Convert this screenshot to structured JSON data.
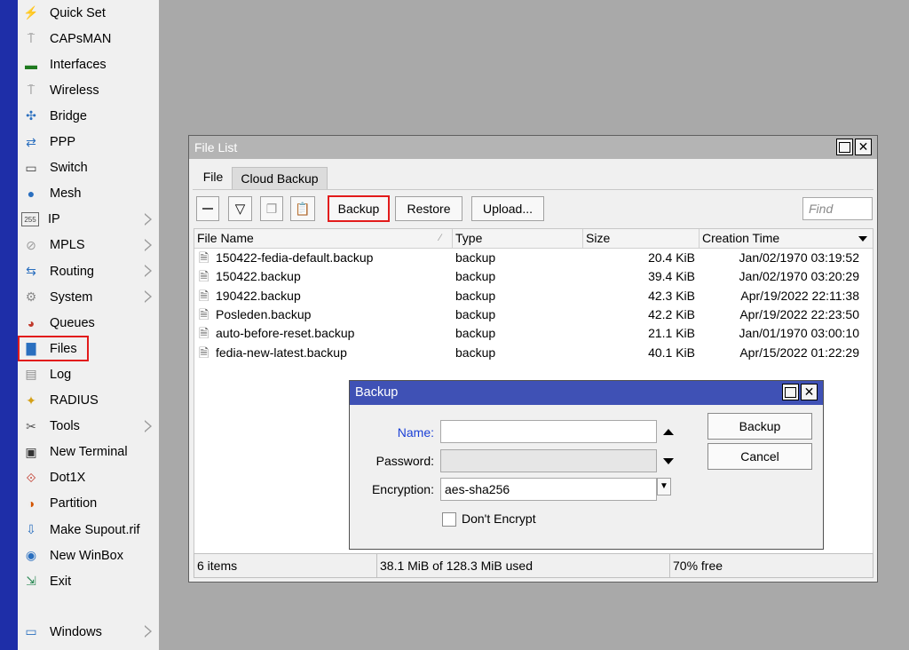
{
  "sidebar": {
    "items": [
      {
        "label": "Quick Set",
        "icon": "wand-icon",
        "glyph": "⚡",
        "color": "#b08900",
        "submenu": false
      },
      {
        "label": "CAPsMAN",
        "icon": "antenna-icon",
        "glyph": "⍑",
        "color": "#7a7a7a",
        "submenu": false
      },
      {
        "label": "Interfaces",
        "icon": "interfaces-icon",
        "glyph": "▬",
        "color": "#1f7a1f",
        "submenu": false
      },
      {
        "label": "Wireless",
        "icon": "wireless-icon",
        "glyph": "⍑",
        "color": "#7a7a7a",
        "submenu": false
      },
      {
        "label": "Bridge",
        "icon": "bridge-icon",
        "glyph": "✣",
        "color": "#2a6fbf",
        "submenu": false
      },
      {
        "label": "PPP",
        "icon": "ppp-icon",
        "glyph": "⇄",
        "color": "#2a6fbf",
        "submenu": false
      },
      {
        "label": "Switch",
        "icon": "switch-icon",
        "glyph": "▭",
        "color": "#444444",
        "submenu": false
      },
      {
        "label": "Mesh",
        "icon": "mesh-icon",
        "glyph": "●",
        "color": "#2a6fbf",
        "submenu": false
      },
      {
        "label": "IP",
        "icon": "ip-icon",
        "glyph": "255",
        "color": "#444444",
        "submenu": true
      },
      {
        "label": "MPLS",
        "icon": "mpls-icon",
        "glyph": "⊘",
        "color": "#9a9a9a",
        "submenu": true
      },
      {
        "label": "Routing",
        "icon": "routing-icon",
        "glyph": "⇆",
        "color": "#2a6fbf",
        "submenu": true
      },
      {
        "label": "System",
        "icon": "gear-icon",
        "glyph": "⚙",
        "color": "#8a8a8a",
        "submenu": true
      },
      {
        "label": "Queues",
        "icon": "queues-icon",
        "glyph": "◕",
        "color": "#c0392b",
        "submenu": false
      },
      {
        "label": "Files",
        "icon": "folder-icon",
        "glyph": "▇",
        "color": "#2a6fbf",
        "submenu": false
      },
      {
        "label": "Log",
        "icon": "log-icon",
        "glyph": "▤",
        "color": "#8a8a8a",
        "submenu": false
      },
      {
        "label": "RADIUS",
        "icon": "radius-icon",
        "glyph": "✦",
        "color": "#d4a017",
        "submenu": false
      },
      {
        "label": "Tools",
        "icon": "tools-icon",
        "glyph": "✂",
        "color": "#555555",
        "submenu": true
      },
      {
        "label": "New Terminal",
        "icon": "terminal-icon",
        "glyph": "▣",
        "color": "#333333",
        "submenu": false
      },
      {
        "label": "Dot1X",
        "icon": "dot1x-icon",
        "glyph": "⟐",
        "color": "#c0392b",
        "submenu": false
      },
      {
        "label": "Partition",
        "icon": "partition-icon",
        "glyph": "◑",
        "color": "#d35400",
        "submenu": false
      },
      {
        "label": "Make Supout.rif",
        "icon": "supout-icon",
        "glyph": "⇩",
        "color": "#2a6fbf",
        "submenu": false
      },
      {
        "label": "New WinBox",
        "icon": "winbox-icon",
        "glyph": "◉",
        "color": "#2a6fbf",
        "submenu": false
      },
      {
        "label": "Exit",
        "icon": "exit-icon",
        "glyph": "⇲",
        "color": "#2e8b57",
        "submenu": false
      }
    ],
    "windows_item": {
      "label": "Windows",
      "icon": "windows-icon",
      "glyph": "▭",
      "color": "#2a6fbf",
      "submenu": true
    }
  },
  "filelist": {
    "title": "File List",
    "tabs": [
      "File",
      "Cloud Backup"
    ],
    "buttons": {
      "backup": "Backup",
      "restore": "Restore",
      "upload": "Upload..."
    },
    "find_placeholder": "Find",
    "columns": [
      "File Name",
      "Type",
      "Size",
      "Creation Time"
    ],
    "rows": [
      {
        "name": "150422-fedia-default.backup",
        "type": "backup",
        "size": "20.4 KiB",
        "created": "Jan/02/1970 03:19:52"
      },
      {
        "name": "150422.backup",
        "type": "backup",
        "size": "39.4 KiB",
        "created": "Jan/02/1970 03:20:29"
      },
      {
        "name": "190422.backup",
        "type": "backup",
        "size": "42.3 KiB",
        "created": "Apr/19/2022 22:11:38"
      },
      {
        "name": "Posleden.backup",
        "type": "backup",
        "size": "42.2 KiB",
        "created": "Apr/19/2022 22:23:50"
      },
      {
        "name": "auto-before-reset.backup",
        "type": "backup",
        "size": "21.1 KiB",
        "created": "Jan/01/1970 03:00:10"
      },
      {
        "name": "fedia-new-latest.backup",
        "type": "backup",
        "size": "40.1 KiB",
        "created": "Apr/15/2022 01:22:29"
      }
    ],
    "status": {
      "count": "6 items",
      "usage": "38.1 MiB of 128.3 MiB used",
      "free": "70% free"
    }
  },
  "backup_dialog": {
    "title": "Backup",
    "name_label": "Name:",
    "name_value": "",
    "password_label": "Password:",
    "password_value": "",
    "encryption_label": "Encryption:",
    "encryption_value": "aes-sha256",
    "dont_encrypt_label": "Don't Encrypt",
    "dont_encrypt_checked": false,
    "backup_button": "Backup",
    "cancel_button": "Cancel"
  },
  "colors": {
    "highlight": "#e21b1b",
    "dialog_title": "#3f51b5",
    "name_label": "#1a3fd6"
  }
}
